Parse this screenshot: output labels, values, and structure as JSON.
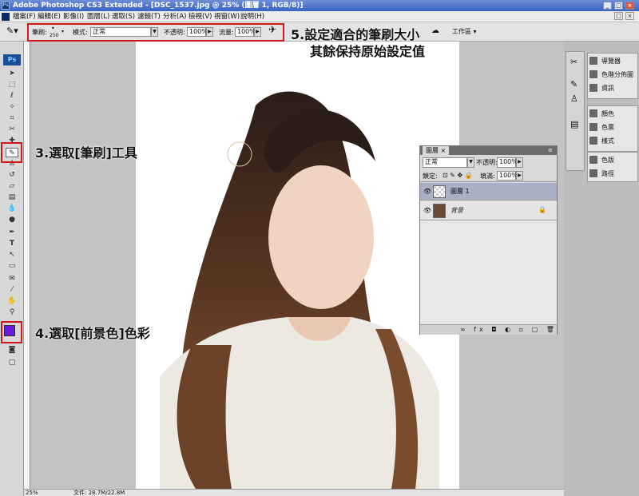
{
  "titlebar": {
    "title": "Adobe Photoshop CS3 Extended - [DSC_1537.jpg @ 25% (圖層 1, RGB/8)]"
  },
  "menu": [
    "檔案(F)",
    "編輯(E)",
    "影像(I)",
    "圖層(L)",
    "選取(S)",
    "濾鏡(T)",
    "分析(A)",
    "檢視(V)",
    "視窗(W)",
    "說明(H)"
  ],
  "options": {
    "brush_label": "筆刷:",
    "brush_size": "250",
    "mode_label": "模式:",
    "mode_value": "正常",
    "opacity_label": "不透明:",
    "opacity_value": "100%",
    "flow_label": "流量:",
    "flow_value": "100%",
    "workspace": "工作區 ▾"
  },
  "annotations": {
    "step3": "3.選取[筆刷]工具",
    "step4": "4.選取[前景色]色彩",
    "step5_line1": "5.設定適合的筆刷大小",
    "step5_line2": "其餘保持原始設定值"
  },
  "colors": {
    "foreground": "#6a1ad8",
    "annotation_box": "#d01818"
  },
  "status": {
    "zoom": "25%",
    "file": "文件: 28.7M/22.8M"
  },
  "dock": {
    "group1": [
      "導覽器",
      "色階分佈圖",
      "資訊"
    ],
    "group2": [
      "顏色",
      "色票",
      "樣式"
    ],
    "group3": [
      "色版",
      "路徑"
    ]
  },
  "layers_panel": {
    "tab": "圖層",
    "blend_mode": "正常",
    "opacity_label": "不透明:",
    "opacity_value": "100%",
    "lock_label": "鎖定:",
    "fill_label": "填滿:",
    "fill_value": "100%",
    "layers": [
      {
        "name": "圖層 1",
        "selected": true
      },
      {
        "name": "背景",
        "selected": false,
        "locked": true
      }
    ]
  }
}
